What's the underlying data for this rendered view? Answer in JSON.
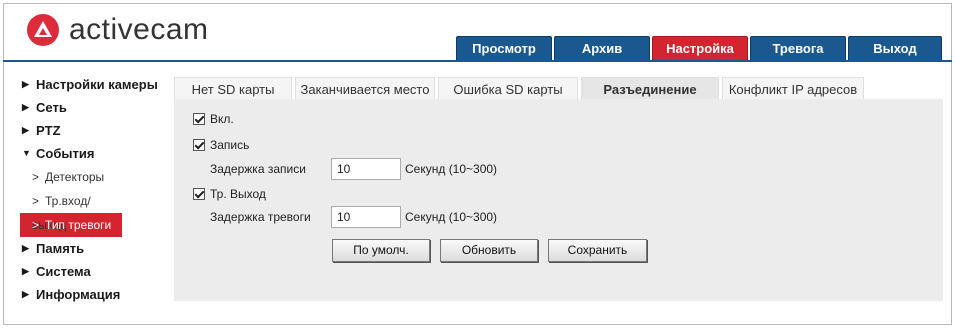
{
  "brand": {
    "name": "activecam"
  },
  "topnav": [
    "Просмотр",
    "Архив",
    "Настройка",
    "Тревога",
    "Выход"
  ],
  "sidebar": {
    "camera_settings": "Настройки камеры",
    "network": "Сеть",
    "ptz": "PTZ",
    "events": "События",
    "events_sub": [
      "Детекторы",
      "Тр.вход/выход",
      "Тип тревоги"
    ],
    "storage": "Память",
    "system": "Система",
    "info": "Информация"
  },
  "subtabs": [
    "Нет SD карты",
    "Заканчивается место",
    "Ошибка SD карты",
    "Разъединение",
    "Конфликт IP адресов"
  ],
  "form": {
    "enable_label": "Вкл.",
    "record_label": "Запись",
    "record_delay_label": "Задержка записи",
    "record_delay_value": "10",
    "record_delay_unit": "Секунд (10~300)",
    "alarm_out_label": "Тр. Выход",
    "alarm_delay_label": "Задержка тревоги",
    "alarm_delay_value": "10",
    "alarm_delay_unit": "Секунд (10~300)"
  },
  "buttons": {
    "default": "По умолч.",
    "refresh": "Обновить",
    "save": "Сохранить"
  },
  "colors": {
    "nav_blue": "#1b5890",
    "accent_red": "#d3242f"
  }
}
